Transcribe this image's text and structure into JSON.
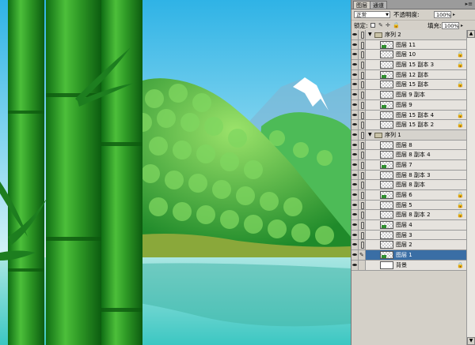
{
  "panel": {
    "tabs": [
      "图层",
      "通道"
    ],
    "blend_mode": "正常",
    "opacity_label": "不透明度:",
    "opacity_value": "100%",
    "lock_label": "锁定:",
    "fill_label": "填充:",
    "fill_value": "100%",
    "menu_icon": "panel-menu-arrow-icon"
  },
  "layers": [
    {
      "name": "序列 2",
      "kind": "group"
    },
    {
      "name": "图层 11",
      "kind": "layer"
    },
    {
      "name": "图层 10",
      "kind": "layer",
      "locked": true
    },
    {
      "name": "图层 15 副本 3",
      "kind": "layer",
      "locked": true
    },
    {
      "name": "图层 12 副本",
      "kind": "layer"
    },
    {
      "name": "图层 15 副本",
      "kind": "layer",
      "locked": true
    },
    {
      "name": "图层 9 副本",
      "kind": "layer"
    },
    {
      "name": "图层 9",
      "kind": "layer"
    },
    {
      "name": "图层 15 副本 4",
      "kind": "layer",
      "locked": true
    },
    {
      "name": "图层 15 副本 2",
      "kind": "layer",
      "locked": true
    },
    {
      "name": "序列 1",
      "kind": "group"
    },
    {
      "name": "图层 8",
      "kind": "layer"
    },
    {
      "name": "图层 8 副本 4",
      "kind": "layer"
    },
    {
      "name": "图层 7",
      "kind": "layer"
    },
    {
      "name": "图层 8 副本 3",
      "kind": "layer"
    },
    {
      "name": "图层 8 副本",
      "kind": "layer"
    },
    {
      "name": "图层 6",
      "kind": "layer",
      "locked": true
    },
    {
      "name": "图层 5",
      "kind": "layer",
      "locked": true
    },
    {
      "name": "图层 8 副本 2",
      "kind": "layer",
      "locked": true
    },
    {
      "name": "图层 4",
      "kind": "layer"
    },
    {
      "name": "图层 3",
      "kind": "layer"
    },
    {
      "name": "图层 2",
      "kind": "layer"
    },
    {
      "name": "图层 1",
      "kind": "layer",
      "selected": true
    },
    {
      "name": "背景",
      "kind": "background",
      "locked": true
    }
  ],
  "colors": {
    "sky_top": "#36b8e8",
    "sky_bottom": "#c8eef8",
    "bamboo": "#2e9b2a",
    "water": "#6fd4d8",
    "selected": "#3a6ea5"
  }
}
